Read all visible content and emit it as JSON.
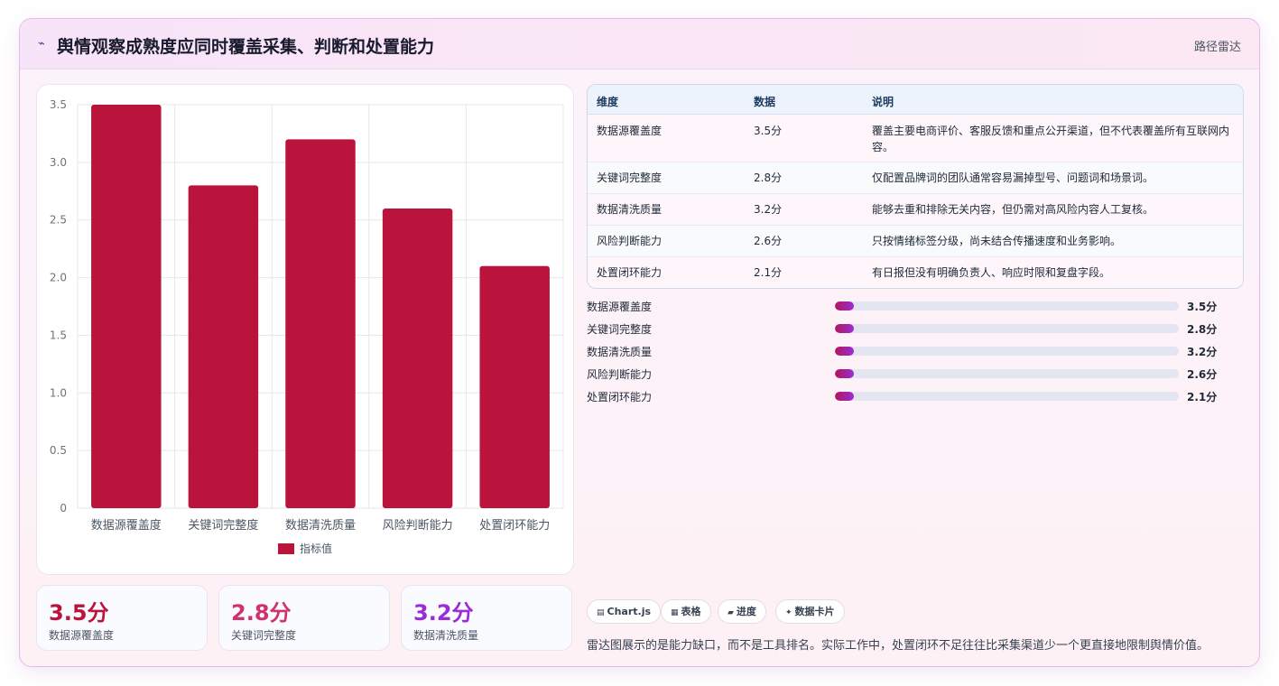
{
  "header": {
    "icon": "sparkle-icon",
    "title": "舆情观察成熟度应同时覆盖采集、判断和处置能力",
    "link": "路径雷达"
  },
  "chart_data": {
    "type": "bar",
    "categories": [
      "数据源覆盖度",
      "关键词完整度",
      "数据清洗质量",
      "风险判断能力",
      "处置闭环能力"
    ],
    "series": [
      {
        "name": "指标值",
        "values": [
          3.5,
          2.8,
          3.2,
          2.6,
          2.1
        ]
      }
    ],
    "ylim": [
      0,
      3.5
    ],
    "yticks": [
      "0",
      "0.5",
      "1.0",
      "1.5",
      "2.0",
      "2.5",
      "3.0",
      "3.5"
    ],
    "grid": true,
    "legend": "bottom",
    "color": "#bb143c"
  },
  "stats": [
    {
      "value": "3.5分",
      "label": "数据源覆盖度",
      "color": "#bb143c"
    },
    {
      "value": "2.8分",
      "label": "关键词完整度",
      "color": "#d1326e"
    },
    {
      "value": "3.2分",
      "label": "数据清洗质量",
      "color": "#9b2bd6"
    }
  ],
  "table": {
    "headers": [
      "维度",
      "数据",
      "说明"
    ],
    "rows": [
      {
        "dim": "数据源覆盖度",
        "val": "3.5分",
        "desc": "覆盖主要电商评价、客服反馈和重点公开渠道，但不代表覆盖所有互联网内容。"
      },
      {
        "dim": "关键词完整度",
        "val": "2.8分",
        "desc": "仅配置品牌词的团队通常容易漏掉型号、问题词和场景词。"
      },
      {
        "dim": "数据清洗质量",
        "val": "3.2分",
        "desc": "能够去重和排除无关内容，但仍需对高风险内容人工复核。"
      },
      {
        "dim": "风险判断能力",
        "val": "2.6分",
        "desc": "只按情绪标签分级，尚未结合传播速度和业务影响。"
      },
      {
        "dim": "处置闭环能力",
        "val": "2.1分",
        "desc": "有日报但没有明确负责人、响应时限和复盘字段。"
      }
    ]
  },
  "progress": [
    {
      "label": "数据源覆盖度",
      "value": "3.5分",
      "fill": 0.055
    },
    {
      "label": "关键词完整度",
      "value": "2.8分",
      "fill": 0.055
    },
    {
      "label": "数据清洗质量",
      "value": "3.2分",
      "fill": 0.055
    },
    {
      "label": "风险判断能力",
      "value": "2.6分",
      "fill": 0.055
    },
    {
      "label": "处置闭环能力",
      "value": "2.1分",
      "fill": 0.055
    }
  ],
  "chips": [
    {
      "icon": "chart-icon",
      "glyph": "▤",
      "label": "Chart.js"
    },
    {
      "icon": "table-icon",
      "glyph": "▦",
      "label": "表格"
    },
    {
      "icon": "progress-icon",
      "glyph": "▰",
      "label": "进度"
    },
    {
      "icon": "card-icon",
      "glyph": "✦",
      "label": "数据卡片"
    }
  ],
  "footer": "雷达图展示的是能力缺口，而不是工具排名。实际工作中，处置闭环不足往往比采集渠道少一个更直接地限制舆情价值。"
}
